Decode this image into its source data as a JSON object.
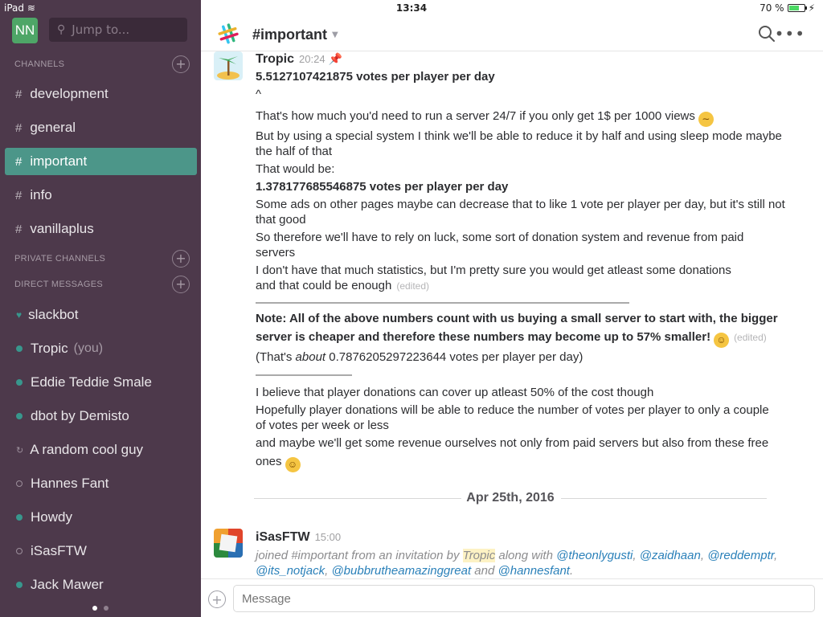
{
  "status_bar": {
    "device": "iPad",
    "time": "13:34",
    "battery": "70 %",
    "battery_level": 0.7
  },
  "sidebar": {
    "team_initials": "NN",
    "jump_placeholder": "Jump to...",
    "channels_header": "CHANNELS",
    "channels": [
      {
        "name": "development"
      },
      {
        "name": "general"
      },
      {
        "name": "important",
        "active": true
      },
      {
        "name": "info"
      },
      {
        "name": "vanillaplus"
      }
    ],
    "private_header": "PRIVATE CHANNELS",
    "dm_header": "DIRECT MESSAGES",
    "dms": [
      {
        "name": "slackbot",
        "status": "heart"
      },
      {
        "name": "Tropic",
        "suffix": "(you)",
        "status": "online"
      },
      {
        "name": "Eddie Teddie Smale",
        "status": "online"
      },
      {
        "name": "dbot by Demisto",
        "status": "online"
      },
      {
        "name": "A random cool guy",
        "status": "bot"
      },
      {
        "name": "Hannes Fant",
        "status": "away"
      },
      {
        "name": "Howdy",
        "status": "online"
      },
      {
        "name": "iSasFTW",
        "status": "away"
      },
      {
        "name": "Jack Mawer",
        "status": "online"
      }
    ]
  },
  "header": {
    "channel": "#important"
  },
  "messages": {
    "tropic": {
      "author": "Tropic",
      "time": "20:24",
      "l1": "5.5127107421875 votes per player per day",
      "l2": "^",
      "l3": "That's how much you'd need to run a server 24/7 if you only get 1$ per 1000 views",
      "l4a": "But by using a special system I think we'll be able to reduce it by half and using sleep mode maybe",
      "l4b": "the half of that",
      "l5": "That would be:",
      "l6": "1.378177685546875 votes per player per day",
      "l7a": "Some ads on other pages maybe can decrease that to like 1 vote per player per day, but it's still not",
      "l7b": "that good",
      "l8a": "So therefore we'll have to rely on luck, some sort of donation system and revenue from paid",
      "l8b": "servers",
      "l9": "I don't have that much statistics, but I'm pretty sure you would get atleast some donations",
      "l10": "and that could be enough",
      "edited": "(edited)",
      "rule1": "———————————————————————————————",
      "note_a": "Note: All of the above numbers count with us buying a small server to start with, the bigger",
      "note_b": "server is cheaper and therefore these numbers may become up to 57% smaller!",
      "thats_pre": "(That's ",
      "thats_about": "about",
      "thats_post": " 0.7876205297223644 votes per player per day)",
      "rule2": "————————",
      "l11": "I believe that player donations can cover up atleast 50% of the cost though",
      "l12a": "Hopefully player donations will be able to reduce the number of votes per player to only a couple",
      "l12b": "of votes per week or less",
      "l13a": "and maybe we'll get some revenue ourselves not only from paid servers but also from these free",
      "l13b": "ones"
    },
    "date_divider": "Apr 25th, 2016",
    "isas": {
      "author": "iSasFTW",
      "time": "15:00",
      "join_pre": "joined #important from an invitation by ",
      "inviter": "Tropic",
      "join_mid": " along with ",
      "m1": "@theonlygusti",
      "m2": "@zaidhaan",
      "m3": "@reddemptr",
      "m4": "@its_notjack",
      "m5": "@bubbrutheamazinggreat",
      "and": " and ",
      "m6": "@hannesfant",
      "comma": ", ",
      "period": "."
    }
  },
  "composer": {
    "placeholder": "Message"
  }
}
